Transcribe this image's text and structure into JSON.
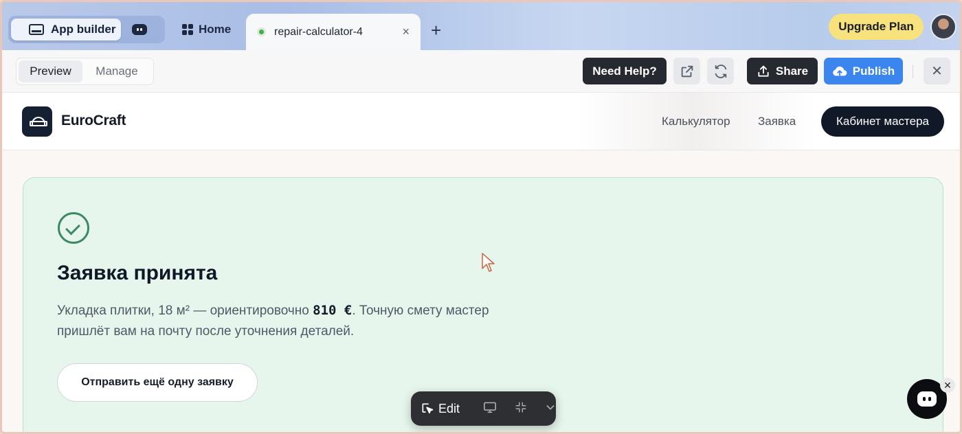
{
  "tabbar": {
    "mode_active_label": "App builder",
    "home_label": "Home",
    "active_tab_label": "repair-calculator-4",
    "close_glyph": "×",
    "add_glyph": "+",
    "upgrade_label": "Upgrade Plan"
  },
  "toolbar": {
    "preview_label": "Preview",
    "manage_label": "Manage",
    "need_help_label": "Need Help?",
    "share_label": "Share",
    "publish_label": "Publish",
    "close_glyph": "✕"
  },
  "app": {
    "brand": "EuroCraft",
    "nav": [
      "Калькулятор",
      "Заявка"
    ],
    "cabinet_label": "Кабинет мастера",
    "card": {
      "title": "Заявка принята",
      "text_before": "Укладка плитки, 18 м² — ориентировочно ",
      "price": "810 €",
      "text_after": ". Точную смету мастер пришлёт вам на почту после уточнения деталей.",
      "again_label": "Отправить ещё одну заявку"
    }
  },
  "edit_bar": {
    "edit_label": "Edit"
  },
  "colors": {
    "publish": "#3b86ee",
    "upgrade": "#f8e27e",
    "card_bg": "#e6f6ec",
    "check": "#3b8a63",
    "dark": "#111827"
  },
  "icons": [
    "monitor-icon",
    "bot-icon",
    "grid-icon",
    "status-dot-icon",
    "external-link-icon",
    "refresh-icon",
    "upload-icon",
    "cloud-upload-icon",
    "helmet-icon",
    "check-circle-icon",
    "cursor-icon",
    "select-cursor-icon",
    "desktop-icon",
    "collapse-icon",
    "chevron-down-icon",
    "chat-icon"
  ]
}
